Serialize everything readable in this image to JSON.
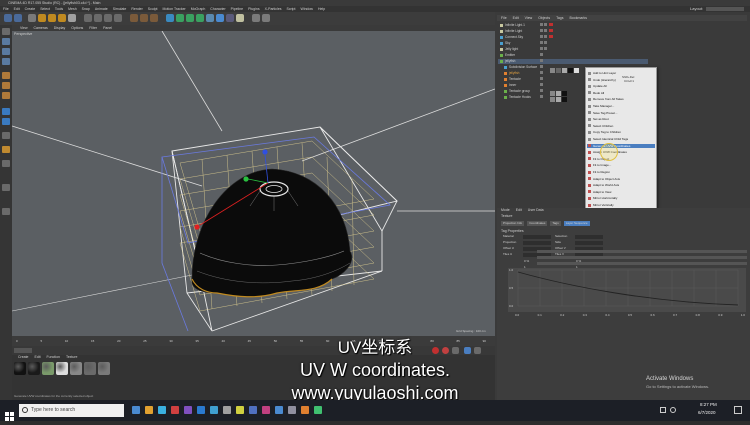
{
  "app": {
    "title": "CINEMA 4D R17.055 Studio (RC) - [jellyfish03.c4d *] - Main",
    "menu": [
      "File",
      "Edit",
      "Create",
      "Select",
      "Tools",
      "Mesh",
      "Snap",
      "Animate",
      "Simulate",
      "Render",
      "Sculpt",
      "Motion Tracker",
      "MoGraph",
      "Character",
      "Pipeline",
      "Plugins",
      "X-Particles",
      "Script",
      "Window",
      "Help"
    ],
    "layout_label": "Layout:",
    "layout_value": "Startup"
  },
  "viewport": {
    "menu": [
      "View",
      "Cameras",
      "Display",
      "Options",
      "Filter",
      "Panel"
    ],
    "camera_label": "Perspective",
    "grid_spacing": "Grid Spacing : 100 cm"
  },
  "timeline": {
    "ticks": [
      "0",
      "5",
      "10",
      "15",
      "20",
      "25",
      "30",
      "35",
      "40",
      "45",
      "50",
      "55",
      "60",
      "65",
      "70",
      "75",
      "80",
      "85",
      "90"
    ],
    "current_frame": "0 F"
  },
  "materials": {
    "menu": [
      "Create",
      "Edit",
      "Function",
      "Texture"
    ],
    "colors": [
      "#111111",
      "#1a1a1a",
      "#7a9a6a",
      "#dddddd",
      "#888888",
      "#6a6a6a",
      "#7a7a7a"
    ]
  },
  "object_manager": {
    "menu": [
      "File",
      "Edit",
      "View",
      "Objects",
      "Tags",
      "Bookmarks"
    ],
    "rows": [
      {
        "name": "Infinite Light.1",
        "icon_color": "#c8c8a0"
      },
      {
        "name": "Infinite Light",
        "icon_color": "#c8c8a0"
      },
      {
        "name": "Connect.Sky",
        "icon_color": "#4aa0d0"
      },
      {
        "name": "Sky",
        "icon_color": "#4aa0d0"
      },
      {
        "name": "Jelly light",
        "icon_color": "#c8c8a0"
      },
      {
        "name": "Emitter",
        "icon_color": "#6ab04a"
      },
      {
        "name": "jellyfish",
        "icon_color": "#6ab04a"
      },
      {
        "name": "Subdivision Surface",
        "icon_color": "#4aa0d0"
      },
      {
        "name": "jellyfish",
        "icon_color": "#e08030"
      },
      {
        "name": "Tentacle",
        "icon_color": "#e08030"
      },
      {
        "name": "Inner",
        "icon_color": "#e08030"
      },
      {
        "name": "Tentacle group",
        "icon_color": "#6ab04a"
      },
      {
        "name": "Tentacle Hooks",
        "icon_color": "#6ab04a"
      }
    ]
  },
  "context_menu": {
    "items": [
      "Add to Hint Layer",
      "Undo (Hierarchy)",
      "Update All",
      "Redo All",
      "Remove from All Takes",
      "Take Manager...",
      "Save Tag Preset...",
      "Set as Root",
      "Select Children",
      "Copy Tag to Children",
      "Select Identical Child Tags",
      "Generate UVW Coordinates",
      "Assign UVW Coordinates",
      "Fit to Object",
      "Fit to Image...",
      "Fit to Region",
      "Adapt to Object Axis",
      "Adapt to World Axis",
      "Adapt to View",
      "Mirror Horizontally",
      "Mirror Vertically",
      "Show Help..."
    ],
    "highlighted_index": 11,
    "shortcut_1": "Shift+Del",
    "shortcut_2": "Ctrl+F1"
  },
  "attributes": {
    "menu": [
      "Mode",
      "Edit",
      "User Data"
    ],
    "object_label": "Texture",
    "tabs": [
      "Projection Info",
      "Coordinates",
      "Tags",
      "Layer Sequence"
    ],
    "section": "Tag Properties",
    "fields": [
      {
        "label": "Material",
        "value": "ST"
      },
      {
        "label": "Selection",
        "value": ""
      },
      {
        "label": "Projection",
        "value": "Spherical"
      },
      {
        "label": "Side",
        "value": "Both"
      },
      {
        "label": "Offset U",
        "value": "0 %"
      },
      {
        "label": "Offset V",
        "value": "0 %"
      },
      {
        "label": "Tiles U",
        "value": "1"
      },
      {
        "label": "Tiles V",
        "value": "1"
      }
    ],
    "graph_y": [
      "1.0",
      "0.5",
      "0.0"
    ],
    "graph_x": [
      "0.0",
      "0.1",
      "0.2",
      "0.3",
      "0.4",
      "0.5",
      "0.6",
      "0.7",
      "0.8",
      "0.9",
      "1.0"
    ]
  },
  "watermark": {
    "line1": "Activate Windows",
    "line2": "Go to Settings to activate Windows."
  },
  "subtitles": {
    "line1": "UV坐标系",
    "line2": "UV W coordinates.",
    "line3": "www.yuyulaoshi.com"
  },
  "taskbar": {
    "search_placeholder": "Type here to search",
    "time": "8:27 PM",
    "date": "6/7/2020",
    "icons": [
      "#4a8ad0",
      "#e0a030",
      "#3ab0e0",
      "#d04040",
      "#8050c0",
      "#2a7ad0",
      "#40a0d0",
      "#a0a0a0",
      "#d0d040",
      "#5070c0",
      "#c04080",
      "#4a8ad0",
      "#9090a0",
      "#e08030",
      "#40c070"
    ]
  },
  "status": {
    "text": "Generate UVW coordinates for the currently selected object"
  },
  "colors": {
    "viewport_bg": "#5b5f63",
    "panel_bg": "#3a3a3a",
    "accent": "#4a7ec0",
    "bbox_line": "#dddddd",
    "jelly": "#0b0b0b"
  }
}
